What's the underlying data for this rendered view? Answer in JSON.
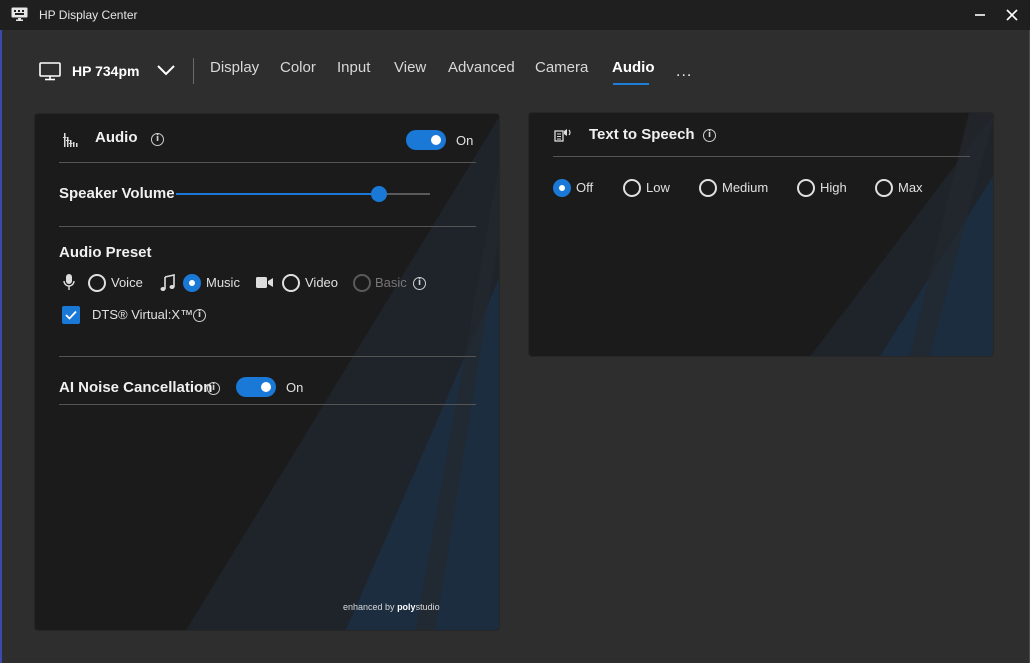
{
  "window": {
    "title": "HP Display Center"
  },
  "device": {
    "name": "HP 734pm"
  },
  "tabs": [
    {
      "label": "Display"
    },
    {
      "label": "Color"
    },
    {
      "label": "Input"
    },
    {
      "label": "View"
    },
    {
      "label": "Advanced"
    },
    {
      "label": "Camera"
    },
    {
      "label": "Audio",
      "active": true
    }
  ],
  "more_label": "...",
  "audio": {
    "title": "Audio",
    "toggle_state": "On",
    "speaker_volume_label": "Speaker Volume",
    "speaker_volume_fraction": 0.8,
    "preset_label": "Audio Preset",
    "presets": [
      {
        "label": "Voice",
        "icon": "microphone-icon",
        "selected": false
      },
      {
        "label": "Music",
        "icon": "music-note-icon",
        "selected": true
      },
      {
        "label": "Video",
        "icon": "video-camera-icon",
        "selected": false
      },
      {
        "label": "Basic",
        "selected": false,
        "disabled": true
      }
    ],
    "dts_label": "DTS® Virtual:X™",
    "dts_checked": true,
    "noise_label": "AI Noise Cancellation",
    "noise_toggle_state": "On",
    "brand_prefix": "enhanced by",
    "brand_poly": "poly",
    "brand_studio": "studio"
  },
  "tts": {
    "title": "Text to Speech",
    "options": [
      {
        "label": "Off",
        "selected": true
      },
      {
        "label": "Low",
        "selected": false
      },
      {
        "label": "Medium",
        "selected": false
      },
      {
        "label": "High",
        "selected": false
      },
      {
        "label": "Max",
        "selected": false
      }
    ]
  },
  "colors": {
    "accent": "#1a78d6",
    "panel": "#1b1b1b",
    "background": "#2e2e2e"
  }
}
